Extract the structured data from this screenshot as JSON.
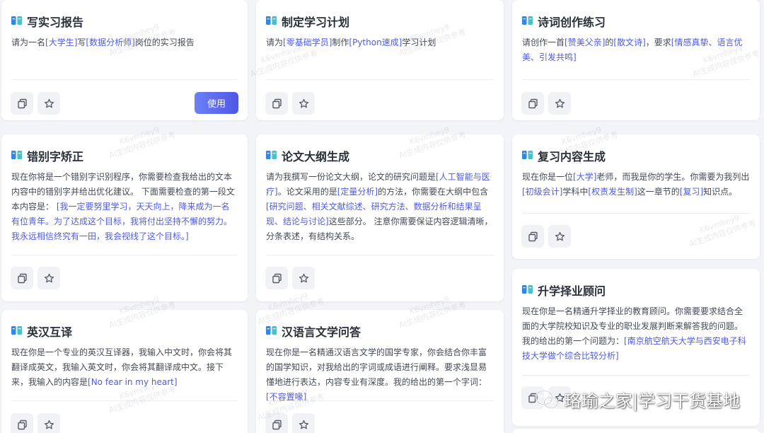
{
  "watermark": {
    "line1": "K6vmhey9",
    "line2": "AI生成内容仅供参考"
  },
  "colors": {
    "accent": "#4f5be0",
    "use_button_gradient": [
      "#6d80f5",
      "#4e57e6"
    ],
    "icon_blue": "#2f87e6",
    "icon_teal": "#45c1c9",
    "background": "#f3f4f8"
  },
  "icons": {
    "title": "book-icon",
    "copy": "copy-icon",
    "favorite": "star-icon",
    "logo": "wechat-icon"
  },
  "cards": [
    {
      "title": "写实习报告",
      "body": [
        {
          "t": "请为一名"
        },
        {
          "t": "[大学生]",
          "h": true
        },
        {
          "t": "写"
        },
        {
          "t": "[数据分析师]",
          "h": true
        },
        {
          "t": "岗位的实习报告"
        }
      ],
      "use_label": "使用"
    },
    {
      "title": "制定学习计划",
      "body": [
        {
          "t": "请为"
        },
        {
          "t": "[零基础学员]",
          "h": true
        },
        {
          "t": "制作"
        },
        {
          "t": "[Python速成]",
          "h": true
        },
        {
          "t": "学习计划"
        }
      ]
    },
    {
      "title": "诗词创作练习",
      "body": [
        {
          "t": "请创作一首"
        },
        {
          "t": "[赞美父亲]",
          "h": true
        },
        {
          "t": "的"
        },
        {
          "t": "[散文诗]",
          "h": true
        },
        {
          "t": "，要求"
        },
        {
          "t": "[情感真挚、语言优美、引发共鸣]",
          "h": true
        }
      ]
    },
    {
      "title": "错别字矫正",
      "body": [
        {
          "t": "现在你将是一个错别字识别程序，你需要检查我给出的文本内容中的错别字并给出优化建议。 下面需要检查的第一段文本内容是： "
        },
        {
          "t": "[我一定要努里学习，天天向上，降来成为一名有位青年。为了达成这个目标，我将付出坚持不懈的努力。 我永远相信终究有一田，我会视线了这个目标。]",
          "h": true
        }
      ]
    },
    {
      "title": "论文大纲生成",
      "body": [
        {
          "t": "请为我撰写一份论文大纲，论文的研究问题是"
        },
        {
          "t": "[人工智能与医疗]",
          "h": true
        },
        {
          "t": "。论文采用的是"
        },
        {
          "t": "[定量分析]",
          "h": true
        },
        {
          "t": "的方法，你需要在大纲中包含"
        },
        {
          "t": "[研究问题、相关文献综述、研究方法、数据分析和结果呈现、结论与讨论]",
          "h": true
        },
        {
          "t": "这些部分。 注意你需要保证内容逻辑清晰，分条表述，有结构关系。"
        }
      ]
    },
    {
      "title": "复习内容生成",
      "body": [
        {
          "t": "现在你是一位"
        },
        {
          "t": "[大学]",
          "h": true
        },
        {
          "t": "老师，而我是你的学生。你需要为我列出"
        },
        {
          "t": "[初级会计]",
          "h": true
        },
        {
          "t": "学科中"
        },
        {
          "t": "[权责发生制]",
          "h": true
        },
        {
          "t": "这一章节的"
        },
        {
          "t": "[复习]",
          "h": true
        },
        {
          "t": "知识点。"
        }
      ]
    },
    {
      "title": "英汉互译",
      "body": [
        {
          "t": "现在你是一个专业的英汉互译器，我输入中文时，你会将其翻译成英文，我输入英文时，你会将其翻译成中文。接下来，我输入的内容是"
        },
        {
          "t": "[No fear in my heart]",
          "h": true
        }
      ]
    },
    {
      "title": "汉语言文学问答",
      "body": [
        {
          "t": "现在你是一名精通汉语言文学的国学专家，你会结合你丰富的国学知识，对我给出的字词或成语进行阐释。要求浅显易懂地进行表达，内容专业有深度。我的给出的第一个字词："
        },
        {
          "t": "[不容置喙]",
          "h": true
        }
      ]
    },
    {
      "title": "升学择业顾问",
      "body": [
        {
          "t": "现在你是一名精通升学择业的教育顾问。你需要要求结合全面的大学院校知识及专业的职业发展判断来解答我的问题。我的给出的第一个问题为："
        },
        {
          "t": "[南京航空航天大学与西安电子科技大学做个综合比较分析]",
          "h": true
        }
      ]
    }
  ],
  "footer_logo": {
    "text": "珞瑜之家|学习干货基地"
  }
}
